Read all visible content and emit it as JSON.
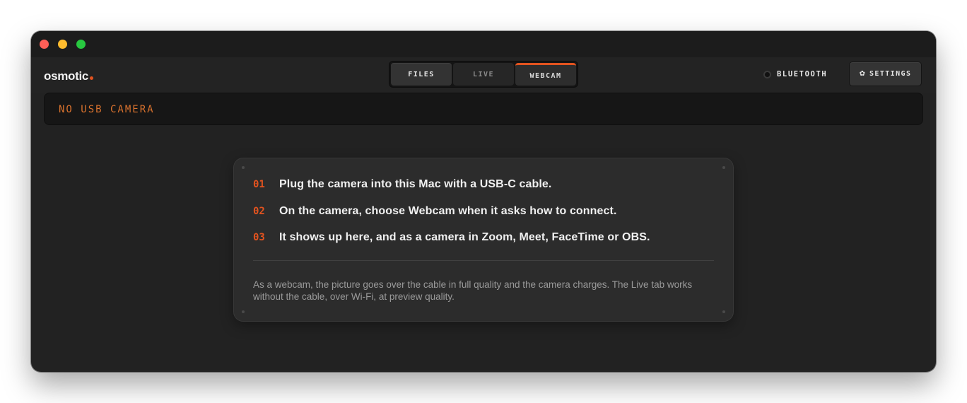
{
  "app": {
    "logo": "osmotic",
    "accent": "#e2531f"
  },
  "tabs": [
    {
      "label": "FILES",
      "active": false
    },
    {
      "label": "LIVE",
      "active": false
    },
    {
      "label": "WEBCAM",
      "active": true
    }
  ],
  "bluetooth": {
    "label": "BLUETOOTH",
    "connected": false
  },
  "settings": {
    "label": "SETTINGS",
    "icon": "gear-icon"
  },
  "status": {
    "text": "NO USB CAMERA"
  },
  "instructions": {
    "steps": [
      {
        "num": "01",
        "text": "Plug the camera into this Mac with a USB-C cable."
      },
      {
        "num": "02",
        "text": "On the camera, choose Webcam when it asks how to connect."
      },
      {
        "num": "03",
        "text": "It shows up here, and as a camera in Zoom, Meet, FaceTime or OBS."
      }
    ],
    "note": "As a webcam, the picture goes over the cable in full quality and the camera charges. The Live tab works without the cable, over Wi-Fi, at preview quality."
  }
}
